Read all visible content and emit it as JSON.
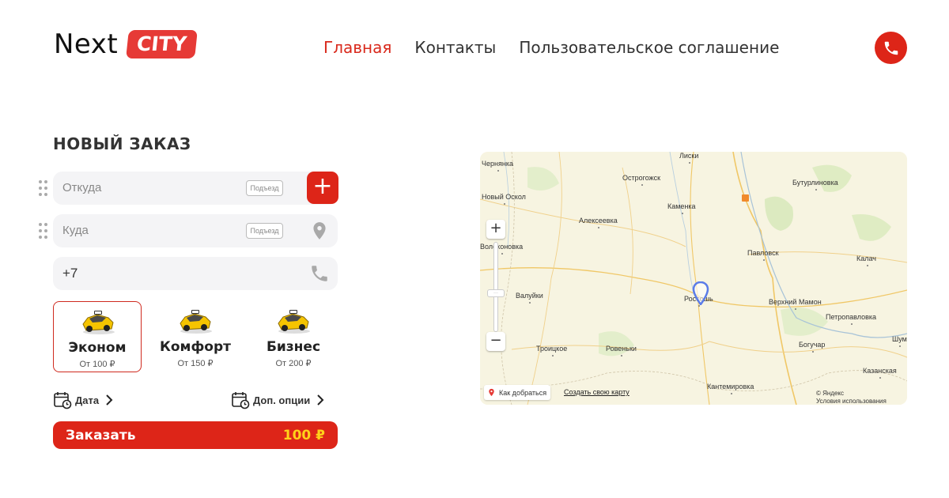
{
  "header": {
    "logo_text": "Next",
    "logo_badge": "CITY",
    "nav": [
      {
        "label": "Главная",
        "active": true
      },
      {
        "label": "Контакты",
        "active": false
      },
      {
        "label": "Пользовательское соглашение",
        "active": false
      }
    ],
    "phone_icon": "phone-icon"
  },
  "order": {
    "title": "НОВЫЙ ЗАКАЗ",
    "from_placeholder": "Откуда",
    "to_placeholder": "Куда",
    "entrance_label": "Подъезд",
    "phone_value": "+7",
    "add_stop_label": "+",
    "tariffs": [
      {
        "name": "Эконом",
        "price": "От 100 ₽",
        "selected": true
      },
      {
        "name": "Комфорт",
        "price": "От 150 ₽",
        "selected": false
      },
      {
        "name": "Бизнес",
        "price": "От 200 ₽",
        "selected": false
      }
    ],
    "date_label": "Дата",
    "options_label": "Доп. опции",
    "submit_label": "Заказать",
    "submit_price": "100 ₽"
  },
  "map": {
    "towns": [
      "Чернянка",
      "Лиски",
      "Острогожск",
      "Бутурлиновка",
      "Новый Оскол",
      "Каменка",
      "Алексеевка",
      "Павловск",
      "Калач",
      "Волоконовка",
      "Валуйки",
      "Россошь",
      "Верхний Мамон",
      "Петропавловка",
      "Троицкое",
      "Ровеньки",
      "Богучар",
      "Шум",
      "Казанская",
      "Кантемировка"
    ],
    "route_label": "Как добраться",
    "create_label": "Создать свою карту",
    "copyright_1": "© Яндекс",
    "copyright_2": "Условия использования",
    "zoom_in": "+",
    "zoom_out": "−"
  },
  "colors": {
    "accent": "#dd2518",
    "price_highlight": "#ffd21a",
    "field_bg": "#f4f4f6"
  }
}
